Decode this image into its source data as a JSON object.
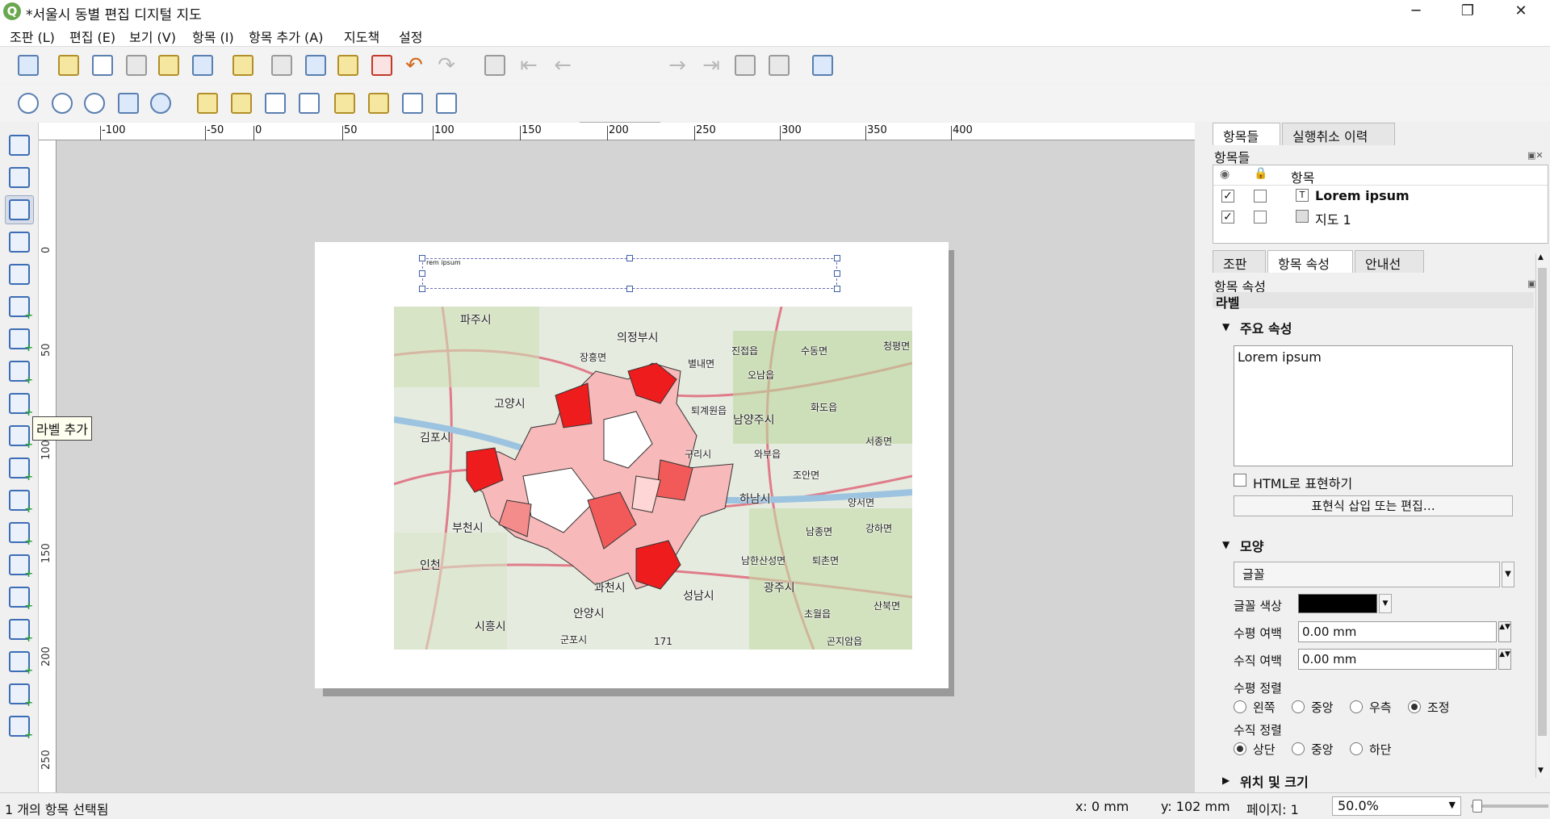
{
  "window": {
    "title": "*서울시 동별 편집 디지털 지도",
    "app_icon": "Q"
  },
  "menu": [
    "조판 (L)",
    "편집 (E)",
    "보기 (V)",
    "항목 (I)",
    "항목 추가 (A)",
    "지도책",
    "설정"
  ],
  "toolbar": {
    "page_number": "1"
  },
  "ruler": {
    "h": [
      "-100",
      "-50",
      "0",
      "50",
      "100",
      "150",
      "200",
      "250",
      "300",
      "350",
      "400"
    ],
    "v": [
      "0",
      "50",
      "100",
      "150",
      "200",
      "250"
    ]
  },
  "tooltip": "라벨 추가",
  "canvas": {
    "label_text": "rem ipsum"
  },
  "map_labels": [
    "파주시",
    "의정부시",
    "고양시",
    "남양주시",
    "김포시",
    "구리시",
    "하남시",
    "부천시",
    "인천",
    "과천시",
    "성남시",
    "광주시",
    "시흥시",
    "안양시",
    "군포시",
    "진접읍",
    "수동면",
    "화도읍",
    "오남읍",
    "별내면",
    "퇴계원읍",
    "와부읍",
    "조안면",
    "서종면",
    "양서면",
    "남종면",
    "퇴촌면",
    "강하면",
    "산북면",
    "남한산성면",
    "초월읍",
    "곤지암읍",
    "장흥면",
    "청평면",
    "171"
  ],
  "right": {
    "tabs_top": [
      "항목들",
      "실행취소 이력"
    ],
    "items_panel_title": "항목들",
    "items_col": "항목",
    "items": [
      {
        "name": "Lorem ipsum",
        "visible": true,
        "locked": false,
        "icon": "text-icon"
      },
      {
        "name": "지도 1",
        "visible": true,
        "locked": false,
        "icon": "map-icon"
      }
    ],
    "tabs_mid": [
      "조판",
      "항목 속성",
      "안내선"
    ],
    "props_title": "항목 속성",
    "props_sub": "라벨",
    "section_main": "주요 속성",
    "label_text": "Lorem ipsum",
    "html_checkbox": "HTML로 표현하기",
    "expr_button": "표현식 삽입 또는 편집…",
    "section_appearance": "모양",
    "font_button": "글꼴",
    "font_color_label": "글꼴 색상",
    "font_color": "#000000",
    "h_margin_label": "수평 여백",
    "h_margin": "0.00 mm",
    "v_margin_label": "수직 여백",
    "v_margin": "0.00 mm",
    "h_align_label": "수평 정렬",
    "h_align_options": [
      "왼쪽",
      "중앙",
      "우측",
      "조정"
    ],
    "h_align_selected": 3,
    "v_align_label": "수직 정렬",
    "v_align_options": [
      "상단",
      "중앙",
      "하단"
    ],
    "v_align_selected": 0,
    "section_position": "위치 및 크기"
  },
  "status": {
    "selection": "1 개의 항목 선택됨",
    "x": "x: 0 mm",
    "y": "y: 102 mm",
    "page": "페이지: 1",
    "zoom": "50.0%"
  }
}
